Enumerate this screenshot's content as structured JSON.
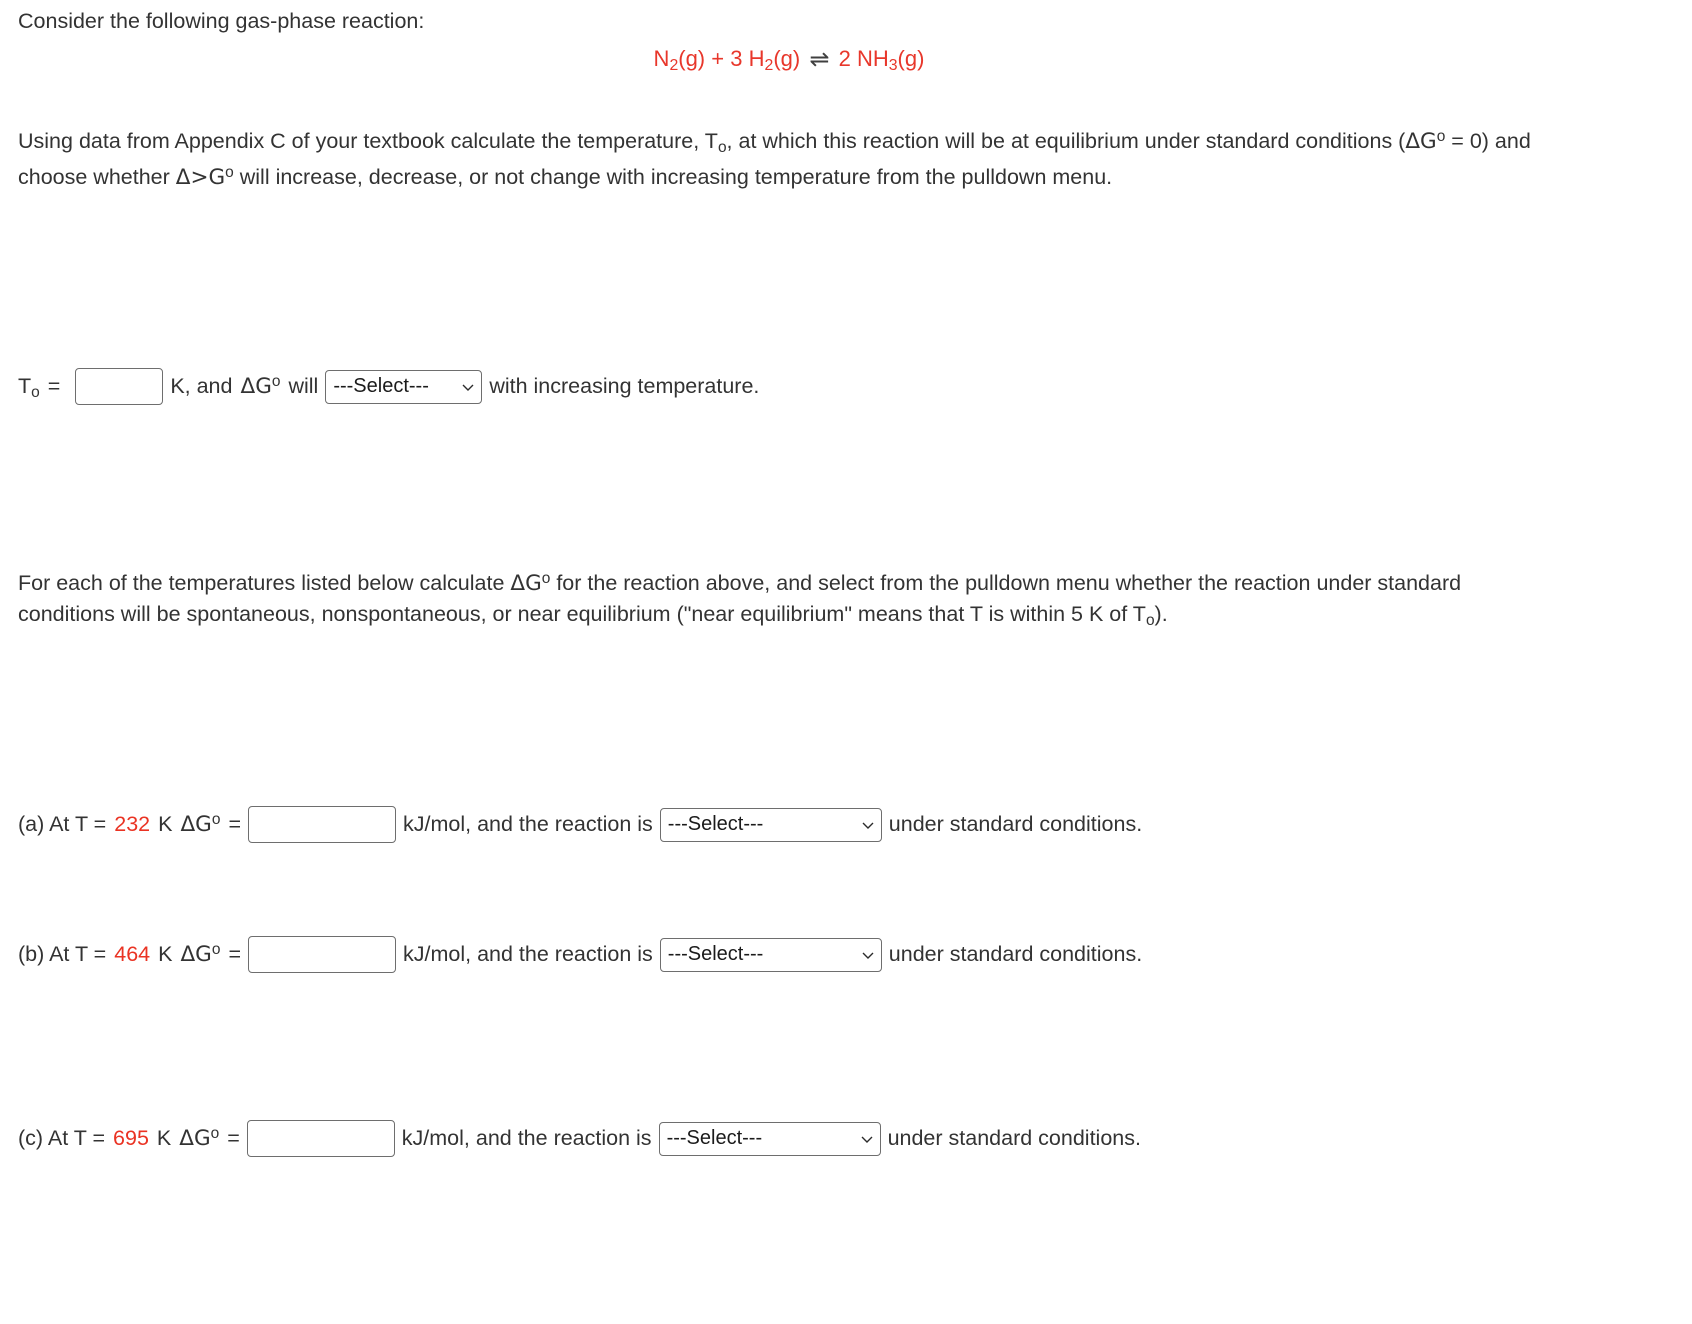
{
  "problem": {
    "intro_line": "Consider the following gas-phase reaction:",
    "equation": {
      "reactant1": "N",
      "reactant1_sub": "2",
      "reactant1_state": "(g)",
      "plus": "+",
      "coeff2": "3",
      "reactant2": "H",
      "reactant2_sub": "2",
      "reactant2_state": "(g)",
      "arrow": "⇌",
      "coeff3": "2",
      "product": "NH",
      "product_sub": "3",
      "product_state": "(g)",
      "full_text": "N2(g) + 3 H2(g) ⇌ 2 NH3(g)",
      "color": "#e8372b",
      "arrow_color": "#3f3f3f"
    },
    "paragraph1": {
      "part1": "Using data from Appendix C of your textbook calculate the temperature, T",
      "part1_sub": "o",
      "part2": ", at which this reaction will be at equilibrium under standard conditions (",
      "delta_g_1": "ΔG",
      "delta_g_1_sup": "o",
      "part3": " = 0) and choose whether ",
      "delta_g_2": "Δ>G",
      "delta_g_2_sup": "o",
      "part4": " will increase, decrease, or not change with increasing temperature from the pulldown menu."
    },
    "paragraph2": {
      "part1": "For each of the temperatures listed below calculate ",
      "delta_g": "ΔG",
      "delta_g_sup": "o",
      "part2": " for the reaction above, and select from the pulldown menu whether the reaction under standard conditions will be spontaneous, nonspontaneous, or near equilibrium (\"near equilibrium\" means that T is within 5 K of T",
      "part2_sub": "o",
      "part3": ")."
    }
  },
  "answer_top": {
    "label_t": "T",
    "label_t_sub": "o",
    "equals": "=",
    "input_value": "",
    "input_placeholder": "",
    "unit": "K, and",
    "delta_g": "ΔG",
    "delta_g_sup": "o",
    "will": "will",
    "select_value": "---Select---",
    "select_options": [
      "---Select---",
      "increase",
      "decrease",
      "not change"
    ],
    "trailing": "with increasing temperature."
  },
  "answer_rows": [
    {
      "id": "a",
      "prefix": "(a) At T =",
      "temperature": "232",
      "unit_k": "K",
      "delta_g": "ΔG",
      "delta_g_sup": "o",
      "equals": "=",
      "input_value": "",
      "input_placeholder": "",
      "unit": "kJ/mol, and the reaction is",
      "select_value": "---Select---",
      "select_options": [
        "---Select---",
        "spontaneous",
        "nonspontaneous",
        "near equilibrium"
      ],
      "trailing": "under standard conditions."
    },
    {
      "id": "b",
      "prefix": "(b) At T =",
      "temperature": "464",
      "unit_k": "K",
      "delta_g": "ΔG",
      "delta_g_sup": "o",
      "equals": "=",
      "input_value": "",
      "input_placeholder": "",
      "unit": "kJ/mol, and the reaction is",
      "select_value": "---Select---",
      "select_options": [
        "---Select---",
        "spontaneous",
        "nonspontaneous",
        "near equilibrium"
      ],
      "trailing": "under standard conditions."
    },
    {
      "id": "c",
      "prefix": "(c) At T =",
      "temperature": "695",
      "unit_k": "K",
      "delta_g": "ΔG",
      "delta_g_sup": "o",
      "equals": "=",
      "input_value": "",
      "input_placeholder": "",
      "unit": "kJ/mol, and the reaction is",
      "select_value": "---Select---",
      "select_options": [
        "---Select---",
        "spontaneous",
        "nonspontaneous",
        "near equilibrium"
      ],
      "trailing": "under standard conditions."
    }
  ],
  "colors": {
    "text": "#333333",
    "accent_red": "#ea3323",
    "equation_red": "#e8372b",
    "border": "#6e6e6e",
    "background": "#ffffff"
  }
}
